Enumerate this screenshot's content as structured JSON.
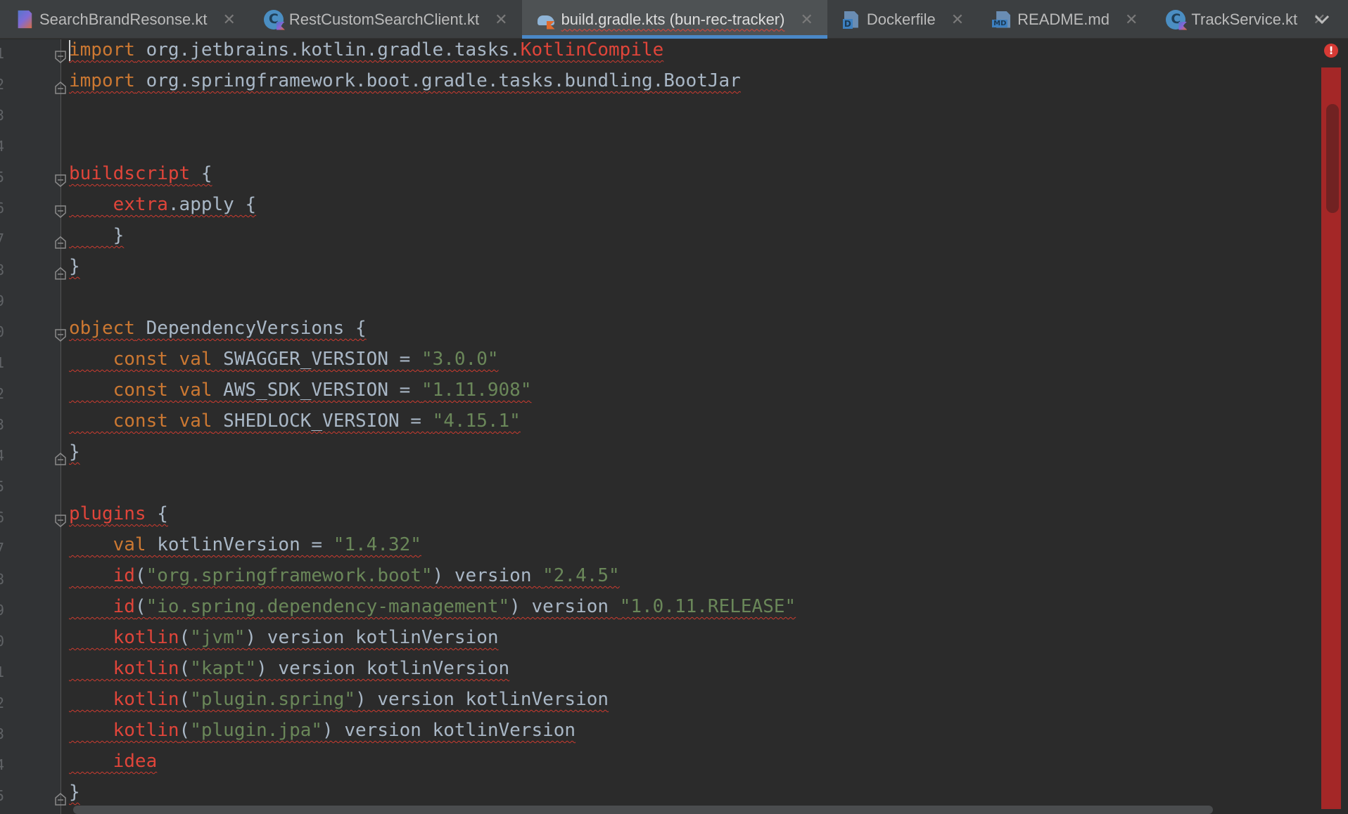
{
  "tabs": [
    {
      "label": "SearchBrandResonse.kt",
      "icon": "kotlin-file-icon",
      "active": false
    },
    {
      "label": "RestCustomSearchClient.kt",
      "icon": "kotlin-class-icon",
      "active": false
    },
    {
      "label": "build.gradle.kts (bun-rec-tracker)",
      "icon": "gradle-icon",
      "active": true
    },
    {
      "label": "Dockerfile",
      "icon": "dockerfile-icon",
      "active": false
    },
    {
      "label": "README.md",
      "icon": "markdown-icon",
      "active": false
    },
    {
      "label": "TrackService.kt",
      "icon": "kotlin-class-icon",
      "active": false
    }
  ],
  "tab_close_glyph": "✕",
  "line_numbers": [
    "1",
    "2",
    "3",
    "4",
    "5",
    "6",
    "7",
    "8",
    "9",
    "0",
    "1",
    "2",
    "3",
    "4",
    "5",
    "6",
    "7",
    "8",
    "9",
    "0",
    "1",
    "2",
    "3",
    "4",
    "5"
  ],
  "code": {
    "l1": {
      "kw": "import",
      "pkg": " org.jetbrains.kotlin.gradle.tasks.",
      "err": "KotlinCompile"
    },
    "l2": {
      "kw": "import",
      "pkg": " org.springframework.boot.gradle.tasks.bundling.BootJar"
    },
    "l5": {
      "kw": "buildscript",
      "rest": " {"
    },
    "l6": {
      "indent": "    ",
      "kw": "extra",
      "rest": ".apply {"
    },
    "l7": {
      "indent": "    ",
      "rest": "}"
    },
    "l8": {
      "rest": "}"
    },
    "l10": {
      "kw": "object",
      "rest": " DependencyVersions {"
    },
    "l11": {
      "indent": "    ",
      "kw": "const val",
      "name": " SWAGGER_VERSION = ",
      "str": "\"3.0.0\""
    },
    "l12": {
      "indent": "    ",
      "kw": "const val",
      "name": " AWS_SDK_VERSION = ",
      "str": "\"1.11.908\""
    },
    "l13": {
      "indent": "    ",
      "kw": "const val",
      "name": " SHEDLOCK_VERSION = ",
      "str": "\"4.15.1\""
    },
    "l14": {
      "rest": "}"
    },
    "l16": {
      "kw": "plugins",
      "rest": " {"
    },
    "l17": {
      "indent": "    ",
      "kw": "val",
      "name": " kotlinVersion = ",
      "str": "\"1.4.32\""
    },
    "l18": {
      "indent": "    ",
      "fn": "id",
      "p1": "(",
      "str": "\"org.springframework.boot\"",
      "p2": ") version ",
      "str2": "\"2.4.5\""
    },
    "l19": {
      "indent": "    ",
      "fn": "id",
      "p1": "(",
      "str": "\"io.spring.dependency-management\"",
      "p2": ") version ",
      "str2": "\"1.0.11.RELEASE\""
    },
    "l20": {
      "indent": "    ",
      "fn": "kotlin",
      "p1": "(",
      "str": "\"jvm\"",
      "p2": ") version kotlinVersion"
    },
    "l21": {
      "indent": "    ",
      "fn": "kotlin",
      "p1": "(",
      "str": "\"kapt\"",
      "p2": ") version kotlinVersion"
    },
    "l22": {
      "indent": "    ",
      "fn": "kotlin",
      "p1": "(",
      "str": "\"plugin.spring\"",
      "p2": ") version kotlinVersion"
    },
    "l23": {
      "indent": "    ",
      "fn": "kotlin",
      "p1": "(",
      "str": "\"plugin.jpa\"",
      "p2": ") version kotlinVersion"
    },
    "l24": {
      "indent": "    ",
      "fn": "idea"
    },
    "l25": {
      "rest": "}"
    }
  },
  "error_stripe_glyph": "!",
  "colors": {
    "keyword": "#cc7832",
    "string": "#6a8759",
    "error": "#e0453a",
    "plain": "#a9b7c6",
    "active_tab_underline": "#4a88c7"
  }
}
